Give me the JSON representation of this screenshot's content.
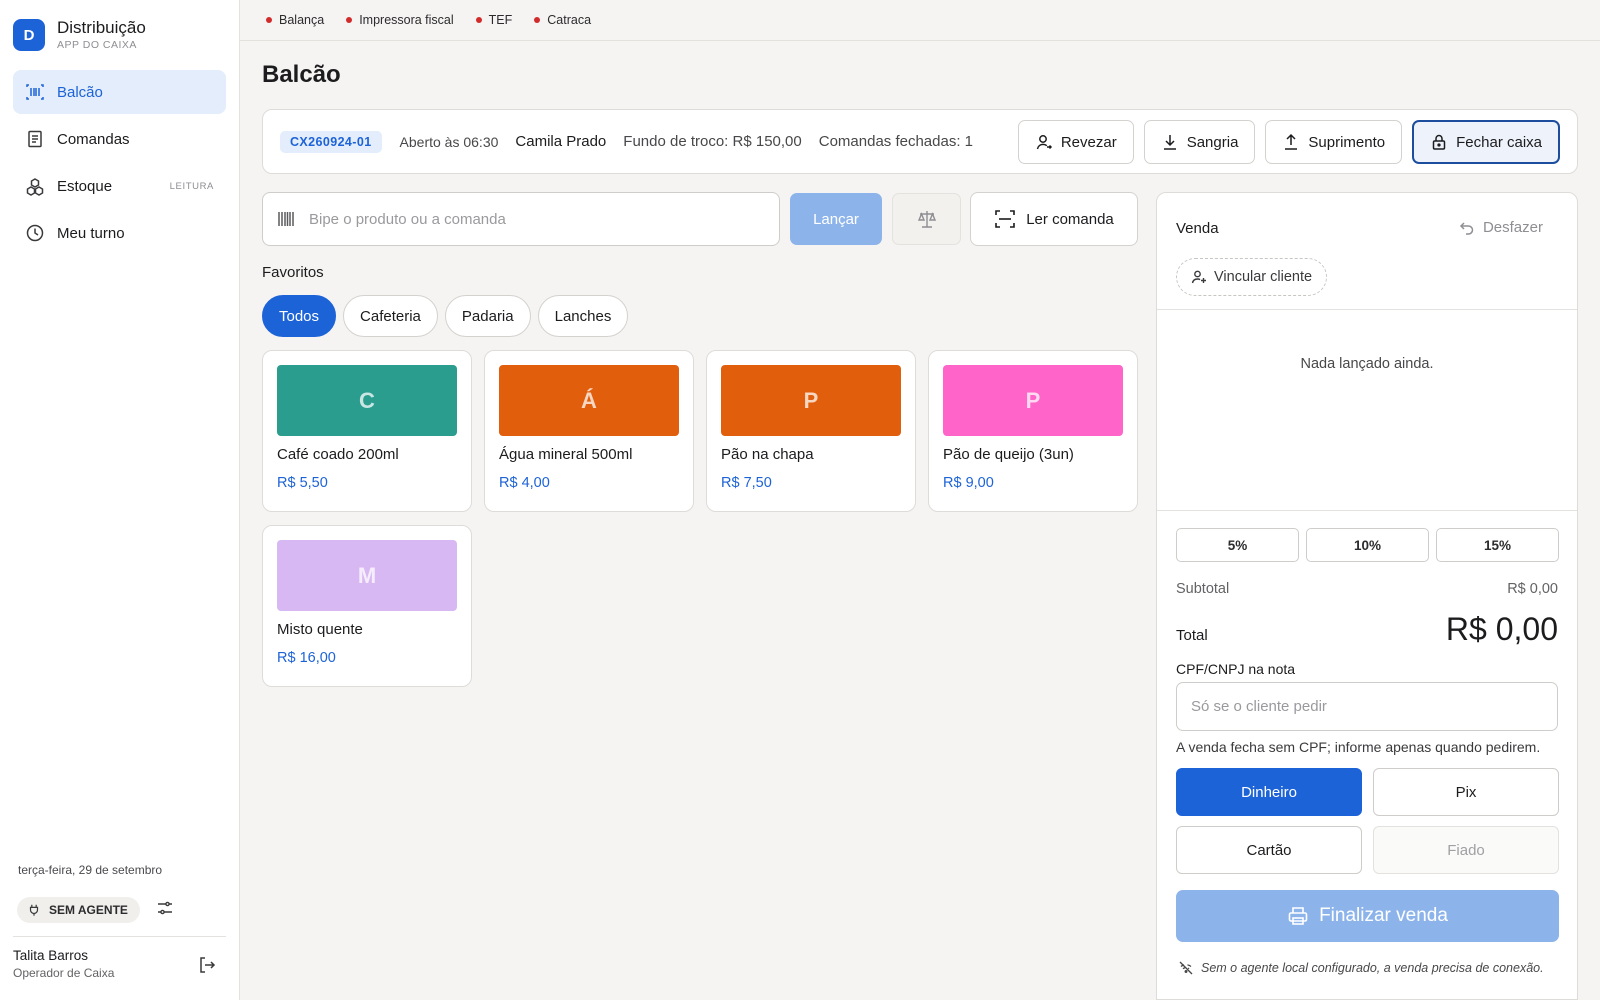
{
  "brand": {
    "initial": "D",
    "title": "Distribuição",
    "subtitle": "APP DO CAIXA"
  },
  "nav": [
    {
      "label": "Balcão",
      "icon": "barcode-icon",
      "active": true,
      "badge": ""
    },
    {
      "label": "Comandas",
      "icon": "receipt-icon",
      "active": false,
      "badge": ""
    },
    {
      "label": "Estoque",
      "icon": "boxes-icon",
      "active": false,
      "badge": "LEITURA"
    },
    {
      "label": "Meu turno",
      "icon": "clock-icon",
      "active": false,
      "badge": ""
    }
  ],
  "sidebar_footer": {
    "date": "terça-feira, 29 de setembro",
    "agent_status": "SEM AGENTE",
    "user_name": "Talita Barros",
    "user_role": "Operador de Caixa"
  },
  "status_bar": [
    {
      "label": "Balança",
      "color": "#d12b2b"
    },
    {
      "label": "Impressora fiscal",
      "color": "#d12b2b"
    },
    {
      "label": "TEF",
      "color": "#d12b2b"
    },
    {
      "label": "Catraca",
      "color": "#d12b2b"
    }
  ],
  "page_title": "Balcão",
  "session": {
    "code": "CX260924-01",
    "opened": "Aberto às 06:30",
    "operator": "Camila Prado",
    "fund": "Fundo de troco: R$ 150,00",
    "closed_orders": "Comandas fechadas: 1",
    "actions": {
      "revezar": "Revezar",
      "sangria": "Sangria",
      "suprimento": "Suprimento",
      "fechar": "Fechar caixa"
    }
  },
  "scan": {
    "placeholder": "Bipe o produto ou a comanda",
    "value": "",
    "launch_label": "Lançar",
    "read_order_label": "Ler comanda"
  },
  "favorites": {
    "title": "Favoritos",
    "chips": [
      {
        "label": "Todos",
        "active": true
      },
      {
        "label": "Cafeteria",
        "active": false
      },
      {
        "label": "Padaria",
        "active": false
      },
      {
        "label": "Lanches",
        "active": false
      }
    ],
    "products": [
      {
        "initial": "C",
        "name": "Café coado 200ml",
        "price": "R$ 5,50",
        "color": "#2a9d8f"
      },
      {
        "initial": "Á",
        "name": "Água mineral 500ml",
        "price": "R$ 4,00",
        "color": "#e05e0c"
      },
      {
        "initial": "P",
        "name": "Pão na chapa",
        "price": "R$ 7,50",
        "color": "#e05e0c"
      },
      {
        "initial": "P",
        "name": "Pão de queijo (3un)",
        "price": "R$ 9,00",
        "color": "#ff64c8"
      },
      {
        "initial": "M",
        "name": "Misto quente",
        "price": "R$ 16,00",
        "color": "#d8b8f2"
      }
    ]
  },
  "sale": {
    "title": "Venda",
    "undo_label": "Desfazer",
    "link_client_label": "Vincular cliente",
    "empty_text": "Nada lançado ainda.",
    "discounts": [
      "5%",
      "10%",
      "15%"
    ],
    "subtotal_label": "Subtotal",
    "subtotal_value": "R$ 0,00",
    "total_label": "Total",
    "total_value": "R$ 0,00",
    "cpf_label": "CPF/CNPJ na nota",
    "cpf_placeholder": "Só se o cliente pedir",
    "cpf_hint": "A venda fecha sem CPF; informe apenas quando pedirem.",
    "payments": [
      {
        "label": "Dinheiro",
        "state": "active"
      },
      {
        "label": "Pix",
        "state": "normal"
      },
      {
        "label": "Cartão",
        "state": "normal"
      },
      {
        "label": "Fiado",
        "state": "disabled"
      }
    ],
    "finalize_label": "Finalizar venda",
    "offline_note": "Sem o agente local configurado, a venda precisa de conexão."
  },
  "colors": {
    "accent": "#1d63d8",
    "accent_soft": "#e3edfb",
    "status_error": "#d12b2b"
  }
}
